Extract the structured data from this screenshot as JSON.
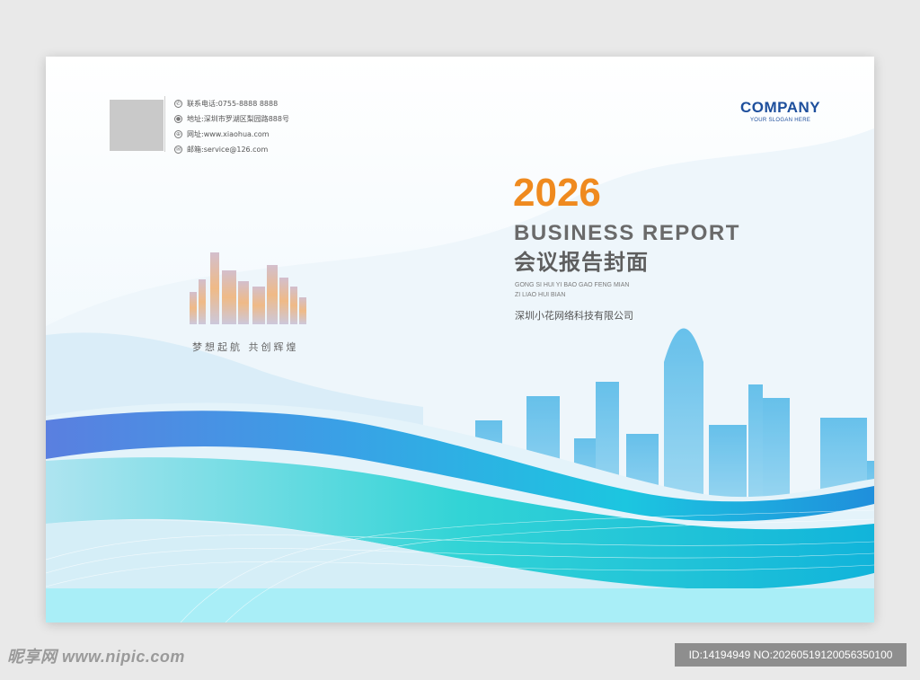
{
  "contacts": [
    {
      "icon": "phone-icon",
      "text": "联系电话:0755-8888 8888"
    },
    {
      "icon": "location-icon",
      "text": "地址:深圳市罗湖区梨园路888号"
    },
    {
      "icon": "globe-icon",
      "text": "网址:www.xiaohua.com"
    },
    {
      "icon": "mail-icon",
      "text": "邮箱:service@126.com"
    }
  ],
  "brand": {
    "name": "COMPANY",
    "slogan": "YOUR SLOGAN HERE",
    "color": "#1e4f9c"
  },
  "cover": {
    "year": "2026",
    "title_en": "BUSINESS REPORT",
    "title_cn": "会议报告封面",
    "pinyin_line1": "GONG SI HUI YI BAO GAO FENG MIAN",
    "pinyin_line2": "ZI LIAO HUI BIAN",
    "company_cn": "深圳小花网络科技有限公司",
    "slogan_cn": "梦想起航  共创辉煌",
    "year_color": "#ef8a1f"
  },
  "watermark": {
    "left": "昵享网 www.nipic.com",
    "right": "ID:14194949 NO:20260519120056350100"
  }
}
